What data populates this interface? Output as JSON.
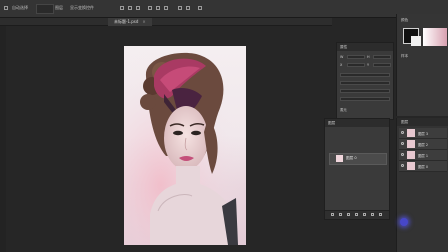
{
  "app": {
    "theme": "dark"
  },
  "options_bar": {
    "items": [
      "自动选择",
      "图层",
      "显示变换控件"
    ]
  },
  "document": {
    "tab_title": "未标题-1.psd",
    "close_glyph": "×"
  },
  "properties": {
    "title": "属性",
    "rows": [
      "W",
      "H",
      "X",
      "Y",
      "蒸元"
    ]
  },
  "right_panel": {
    "label": "颜色",
    "sub": "样本"
  },
  "layers_mini": {
    "title": "图层",
    "layer_name": "图层 0"
  },
  "layers_right": {
    "title": "图层",
    "rows": [
      "图层 3",
      "图层 2",
      "图层 1",
      "图层 0"
    ]
  },
  "colors": {
    "accent_cursor": "#4747c9",
    "panel": "#3a3a3a",
    "background": "#262626"
  }
}
